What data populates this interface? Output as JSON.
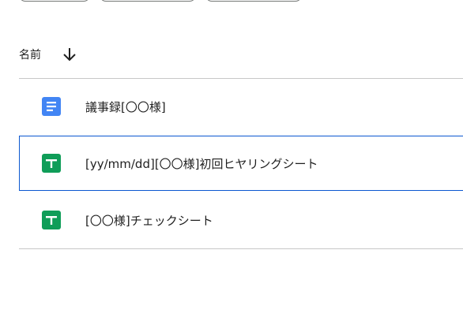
{
  "list": {
    "header": {
      "name_label": "名前",
      "sort_icon": "arrow-down-icon"
    },
    "files": [
      {
        "name": "議事録[〇〇様]",
        "type": "docs",
        "icon": "google-docs-icon",
        "selected": false
      },
      {
        "name": "[yy/mm/dd][〇〇様]初回ヒヤリングシート",
        "type": "sheets",
        "icon": "google-sheets-icon",
        "selected": true
      },
      {
        "name": "[〇〇様]チェックシート",
        "type": "sheets",
        "icon": "google-sheets-icon",
        "selected": false
      }
    ]
  },
  "colors": {
    "docs_blue": "#4285f4",
    "sheets_green": "#0f9d58",
    "selection_border": "#0b57d0",
    "divider": "#c7c7c7"
  }
}
